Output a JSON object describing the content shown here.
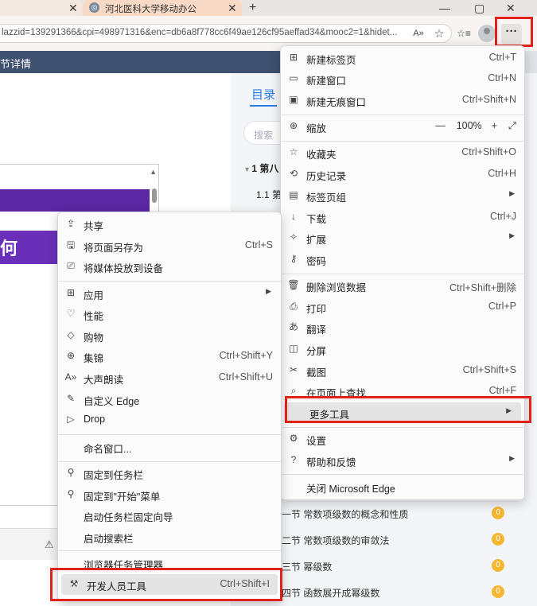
{
  "tabs": {
    "first_close": "✕",
    "active_title": "河北医科大学移动办公",
    "active_close": "✕",
    "new_tab": "+"
  },
  "window": {
    "minimize": "—",
    "maximize": "▢",
    "close": "✕"
  },
  "address_bar": {
    "url": "lazzid=139291366&cpi=498971316&enc=db6a8f778cc6f49ae126cf95aeffad34&mooc2=1&hidet..."
  },
  "toolbar": {
    "read_aloud": "A»",
    "favorite": "☆",
    "favorites": "☆≡",
    "more": "···"
  },
  "page": {
    "header_title": "节详情",
    "toc_tab": "目录",
    "search_placeholder": "搜索",
    "toc_items": [
      {
        "label": "1 第八",
        "prefix": "▾"
      },
      {
        "label": "1.1 第"
      }
    ],
    "big_glyph": "何",
    "warn_icon": "⚠",
    "chapters": [
      {
        "label": "一节  常数项级数的概念和性质",
        "badge": "0"
      },
      {
        "label": "二节  常数项级数的审敛法",
        "badge": "0"
      },
      {
        "label": "三节  幂级数",
        "badge": "0"
      },
      {
        "label": "四节  函数展开成幂级数",
        "badge": "0"
      }
    ]
  },
  "main_menu": {
    "items": [
      {
        "icon": "⊞",
        "label": "新建标签页",
        "shortcut": "Ctrl+T"
      },
      {
        "icon": "▭",
        "label": "新建窗口",
        "shortcut": "Ctrl+N"
      },
      {
        "icon": "▣",
        "label": "新建无痕窗口",
        "shortcut": "Ctrl+Shift+N"
      },
      {
        "icon": "⊕",
        "label": "缩放",
        "zoom_minus": "—",
        "zoom_value": "100%",
        "zoom_plus": "+",
        "fullscreen": "⤢"
      },
      {
        "icon": "☆",
        "label": "收藏夹",
        "shortcut": "Ctrl+Shift+O"
      },
      {
        "icon": "⟲",
        "label": "历史记录",
        "shortcut": "Ctrl+H"
      },
      {
        "icon": "▤",
        "label": "标签页组",
        "arrow": "▶"
      },
      {
        "icon": "↓",
        "label": "下载",
        "shortcut": "Ctrl+J"
      },
      {
        "icon": "✧",
        "label": "扩展",
        "arrow": "▶"
      },
      {
        "icon": "⚷",
        "label": "密码"
      },
      {
        "icon": "🗑",
        "label": "删除浏览数据",
        "shortcut": "Ctrl+Shift+删除"
      },
      {
        "icon": "⎙",
        "label": "打印",
        "shortcut": "Ctrl+P"
      },
      {
        "icon": "あ",
        "label": "翻译"
      },
      {
        "icon": "◫",
        "label": "分屏"
      },
      {
        "icon": "✂",
        "label": "截图",
        "shortcut": "Ctrl+Shift+S"
      },
      {
        "icon": "⌕",
        "label": "在页面上查找",
        "shortcut": "Ctrl+F"
      },
      {
        "icon": "",
        "label": "更多工具",
        "arrow": "▶"
      },
      {
        "icon": "⚙",
        "label": "设置"
      },
      {
        "icon": "?",
        "label": "帮助和反馈",
        "arrow": "▶"
      },
      {
        "icon": "",
        "label": "关闭 Microsoft Edge"
      }
    ]
  },
  "sub_menu": {
    "items": [
      {
        "icon": "⇪",
        "label": "共享"
      },
      {
        "icon": "🖫",
        "label": "将页面另存为",
        "shortcut": "Ctrl+S"
      },
      {
        "icon": "⎚",
        "label": "将媒体投放到设备"
      },
      {
        "icon": "⊞",
        "label": "应用",
        "arrow": "▶"
      },
      {
        "icon": "♡",
        "label": "性能"
      },
      {
        "icon": "◇",
        "label": "购物"
      },
      {
        "icon": "⊕",
        "label": "集锦",
        "shortcut": "Ctrl+Shift+Y"
      },
      {
        "icon": "A»",
        "label": "大声朗读",
        "shortcut": "Ctrl+Shift+U"
      },
      {
        "icon": "✎",
        "label": "自定义 Edge"
      },
      {
        "icon": "▷",
        "label": "Drop"
      },
      {
        "icon": "",
        "label": "命名窗口..."
      },
      {
        "icon": "⚲",
        "label": "固定到任务栏"
      },
      {
        "icon": "⚲",
        "label": "固定到\"开始\"菜单"
      },
      {
        "icon": "",
        "label": "启动任务栏固定向导"
      },
      {
        "icon": "",
        "label": "启动搜索栏"
      },
      {
        "icon": "",
        "label": "浏览器任务管理器"
      },
      {
        "icon": "⚒",
        "label": "开发人员工具",
        "shortcut": "Ctrl+Shift+I"
      }
    ]
  }
}
